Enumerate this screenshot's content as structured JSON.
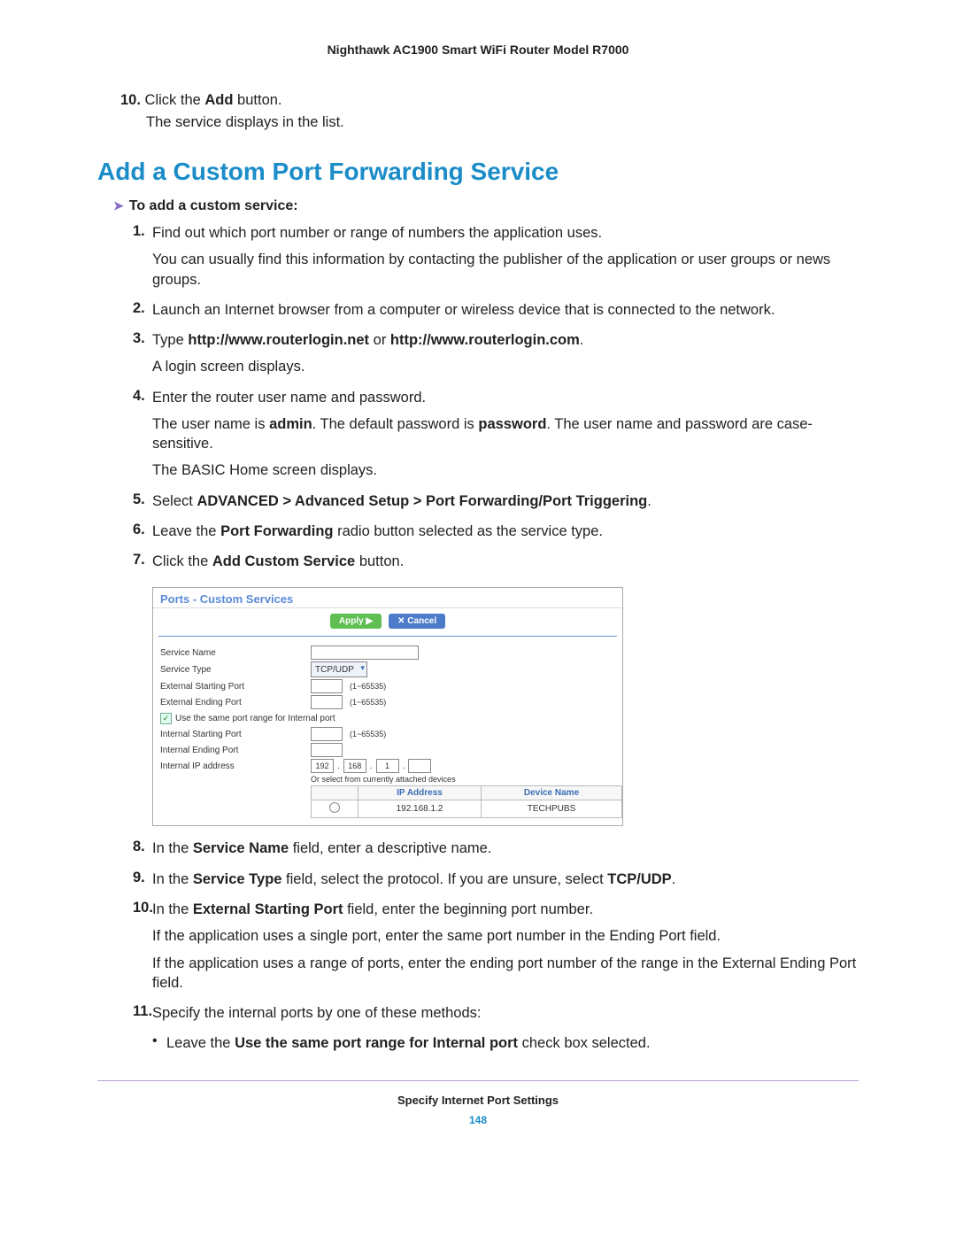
{
  "header": "Nighthawk AC1900 Smart WiFi Router Model R7000",
  "top_step": {
    "num": "10.",
    "text_before": "Click the ",
    "bold": "Add",
    "text_after": " button.",
    "detail": "The service displays in the list."
  },
  "section_heading": "Add a Custom Port Forwarding Service",
  "proc_heading": "To add a custom service:",
  "steps": [
    {
      "num": "1.",
      "paras": [
        {
          "segments": [
            {
              "t": "Find out which port number or range of numbers the application uses."
            }
          ]
        },
        {
          "segments": [
            {
              "t": "You can usually find this information by contacting the publisher of the application or user groups or news groups."
            }
          ]
        }
      ]
    },
    {
      "num": "2.",
      "paras": [
        {
          "segments": [
            {
              "t": "Launch an Internet browser from a computer or wireless device that is connected to the network."
            }
          ]
        }
      ]
    },
    {
      "num": "3.",
      "paras": [
        {
          "segments": [
            {
              "t": "Type "
            },
            {
              "t": "http://www.routerlogin.net",
              "b": true
            },
            {
              "t": " or "
            },
            {
              "t": "http://www.routerlogin.com",
              "b": true
            },
            {
              "t": "."
            }
          ]
        },
        {
          "segments": [
            {
              "t": "A login screen displays."
            }
          ]
        }
      ]
    },
    {
      "num": "4.",
      "paras": [
        {
          "segments": [
            {
              "t": "Enter the router user name and password."
            }
          ]
        },
        {
          "segments": [
            {
              "t": "The user name is "
            },
            {
              "t": "admin",
              "b": true
            },
            {
              "t": ". The default password is "
            },
            {
              "t": "password",
              "b": true
            },
            {
              "t": ". The user name and password are case-sensitive."
            }
          ]
        },
        {
          "segments": [
            {
              "t": "The BASIC Home screen displays."
            }
          ]
        }
      ]
    },
    {
      "num": "5.",
      "paras": [
        {
          "segments": [
            {
              "t": "Select "
            },
            {
              "t": "ADVANCED > Advanced Setup > Port Forwarding/Port Triggering",
              "b": true
            },
            {
              "t": "."
            }
          ]
        }
      ]
    },
    {
      "num": "6.",
      "paras": [
        {
          "segments": [
            {
              "t": "Leave the "
            },
            {
              "t": "Port Forwarding",
              "b": true
            },
            {
              "t": " radio button selected as the service type."
            }
          ]
        }
      ]
    },
    {
      "num": "7.",
      "paras": [
        {
          "segments": [
            {
              "t": "Click the "
            },
            {
              "t": "Add Custom Service",
              "b": true
            },
            {
              "t": " button."
            }
          ]
        }
      ]
    },
    {
      "num": "8.",
      "paras": [
        {
          "segments": [
            {
              "t": "In the "
            },
            {
              "t": "Service Name",
              "b": true
            },
            {
              "t": " field, enter a descriptive name."
            }
          ]
        }
      ]
    },
    {
      "num": "9.",
      "paras": [
        {
          "segments": [
            {
              "t": "In the "
            },
            {
              "t": "Service Type",
              "b": true
            },
            {
              "t": " field, select the protocol. If you are unsure, select "
            },
            {
              "t": "TCP/UDP",
              "b": true
            },
            {
              "t": "."
            }
          ]
        }
      ]
    },
    {
      "num": "10.",
      "paras": [
        {
          "segments": [
            {
              "t": "In the "
            },
            {
              "t": "External Starting Port",
              "b": true
            },
            {
              "t": " field, enter the beginning port number."
            }
          ]
        },
        {
          "segments": [
            {
              "t": "If the application uses a single port, enter the same port number in the Ending Port field."
            }
          ]
        },
        {
          "segments": [
            {
              "t": "If the application uses a range of ports, enter the ending port number of the range in the External Ending Port field."
            }
          ]
        }
      ]
    },
    {
      "num": "11.",
      "paras": [
        {
          "segments": [
            {
              "t": "Specify the internal ports by one of these methods:"
            }
          ]
        }
      ],
      "bullets": [
        {
          "segments": [
            {
              "t": "Leave the "
            },
            {
              "t": "Use the same port range for Internal port",
              "b": true
            },
            {
              "t": " check box selected."
            }
          ]
        }
      ]
    }
  ],
  "router_ui": {
    "title": "Ports - Custom Services",
    "apply_label": "Apply ▶",
    "cancel_label": "✕ Cancel",
    "rows": {
      "service_name": "Service Name",
      "service_type": "Service Type",
      "service_type_value": "TCP/UDP",
      "ext_start": "External Starting Port",
      "ext_end": "External Ending Port",
      "range_hint": "(1~65535)",
      "same_port": "Use the same port range for Internal port",
      "int_start": "Internal Starting Port",
      "int_end": "Internal Ending Port",
      "int_ip": "Internal IP address",
      "ip_oct1": "192",
      "ip_oct2": "168",
      "ip_oct3": "1",
      "attached_note": "Or select from currently attached devices",
      "th_ip": "IP Address",
      "th_device": "Device Name",
      "dev_ip": "192.168.1.2",
      "dev_name": "TECHPUBS"
    }
  },
  "footer_title": "Specify Internet Port Settings",
  "footer_page": "148"
}
